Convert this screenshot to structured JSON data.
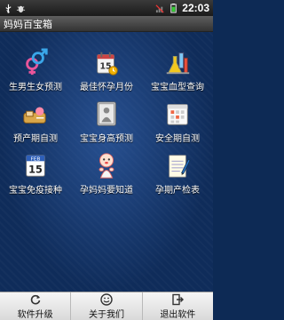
{
  "status_bar": {
    "time": "22:03",
    "icons": [
      "usb-icon",
      "bug-icon",
      "signal-off-icon",
      "battery-icon"
    ]
  },
  "app": {
    "title": "妈妈百宝箱"
  },
  "grid": {
    "items": [
      {
        "label": "生男生女预测",
        "icon": "gender-symbols-icon"
      },
      {
        "label": "最佳怀孕月份",
        "icon": "calendar-icon"
      },
      {
        "label": "宝宝血型查询",
        "icon": "lab-flasks-icon"
      },
      {
        "label": "预产期自测",
        "icon": "baby-bottle-icon"
      },
      {
        "label": "宝宝身高预测",
        "icon": "height-chart-icon"
      },
      {
        "label": "安全期自测",
        "icon": "calendar-grid-icon"
      },
      {
        "label": "宝宝免疫接种",
        "icon": "feb-calendar-icon"
      },
      {
        "label": "孕妈妈要知道",
        "icon": "baby-doll-icon"
      },
      {
        "label": "孕期产检表",
        "icon": "notepad-icon"
      }
    ],
    "calendar_number": "15",
    "feb_label": "FEB"
  },
  "bottom_menu": {
    "items": [
      {
        "label": "软件升级",
        "icon": "refresh-icon"
      },
      {
        "label": "关于我们",
        "icon": "smiley-icon"
      },
      {
        "label": "退出软件",
        "icon": "exit-icon"
      }
    ]
  },
  "colors": {
    "background": "#0f2c5a",
    "status_bar": "#1a1a1a",
    "menu_bg": "#e6e6e6"
  }
}
